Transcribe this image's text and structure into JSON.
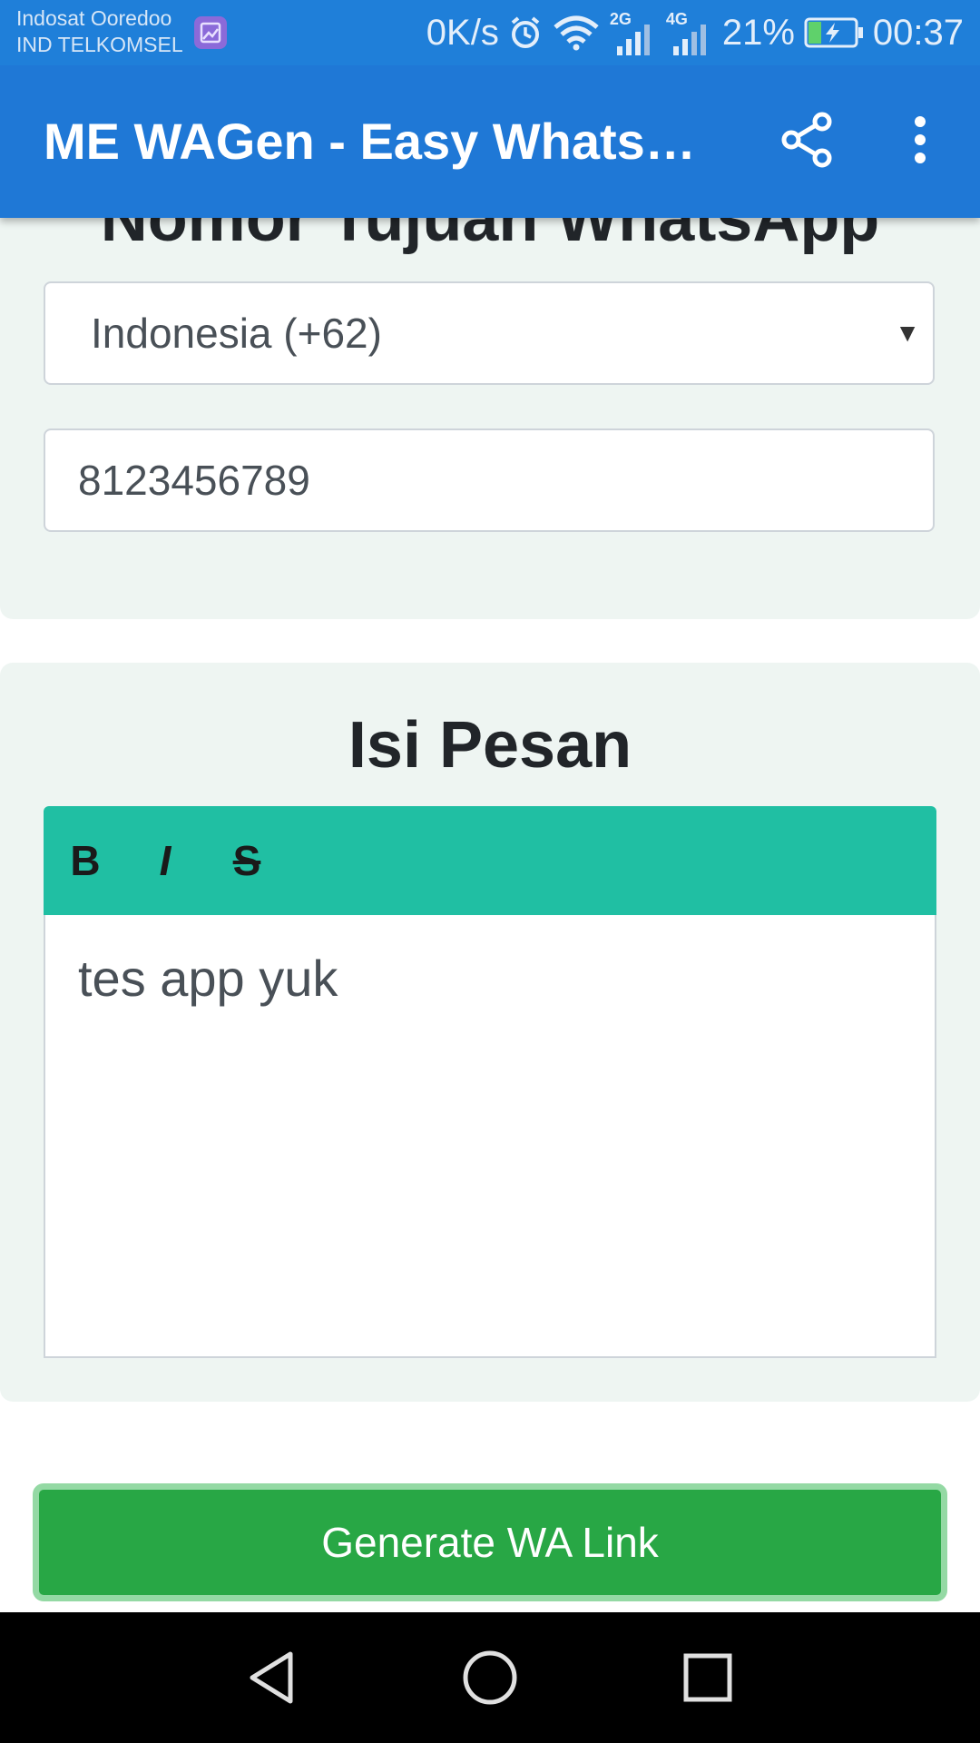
{
  "status_bar": {
    "carrier_1": "Indosat Ooredoo",
    "carrier_2": "IND TELKOMSEL",
    "net_speed": "0K/s",
    "network_1": "2G",
    "network_2": "4G",
    "battery": "21%",
    "time": "00:37",
    "icons": [
      "gallery-icon",
      "alarm-icon",
      "wifi-icon",
      "signal-icon",
      "battery-charging-icon"
    ]
  },
  "app_bar": {
    "title": "ME WAGen - Easy WhatsApp Link Generator",
    "icons": [
      "share-icon",
      "more-vert-icon"
    ],
    "color": "#1f78d6"
  },
  "target_section": {
    "heading": "Nomor Tujuan WhatsApp",
    "country_select": "Indonesia (+62)",
    "phone_value": "8123456789"
  },
  "message_section": {
    "heading": "Isi Pesan",
    "toolbar": {
      "bold": "B",
      "italic": "I",
      "strike": "S"
    },
    "message": "tes app yuk",
    "toolbar_color": "#20bfa3"
  },
  "generate_button": {
    "label": "Generate WA Link",
    "color": "#28a745"
  },
  "nav_bar": {
    "icons": [
      "back-icon",
      "home-icon",
      "recents-icon"
    ]
  }
}
